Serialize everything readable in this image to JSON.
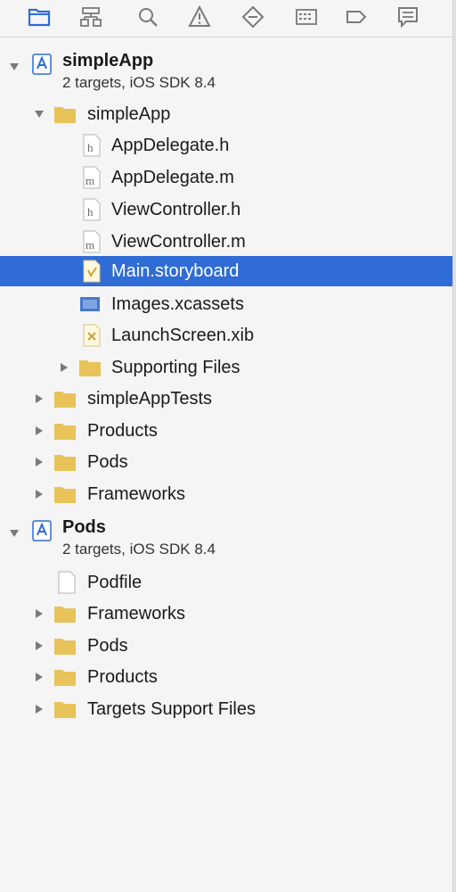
{
  "toolbar": {
    "icons": [
      "project-navigator-icon",
      "symbol-navigator-icon",
      "find-navigator-icon",
      "issue-navigator-icon",
      "test-navigator-icon",
      "debug-navigator-icon",
      "breakpoint-navigator-icon",
      "report-navigator-icon"
    ],
    "accent": "#2f6cd6"
  },
  "projects": [
    {
      "name": "simpleApp",
      "subtitle": "2 targets, iOS SDK 8.4",
      "groups": {
        "simpleApp": {
          "label": "simpleApp",
          "files": {
            "appdelegate_h": {
              "label": "AppDelegate.h",
              "icon": "header-file-icon"
            },
            "appdelegate_m": {
              "label": "AppDelegate.m",
              "icon": "source-file-icon"
            },
            "viewcontroller_h": {
              "label": "ViewController.h",
              "icon": "header-file-icon"
            },
            "viewcontroller_m": {
              "label": "ViewController.m",
              "icon": "source-file-icon"
            },
            "main_storyboard": {
              "label": "Main.storyboard",
              "icon": "storyboard-file-icon",
              "selected": true
            },
            "images_xcassets": {
              "label": "Images.xcassets",
              "icon": "asset-catalog-icon"
            },
            "launchscreen_xib": {
              "label": "LaunchScreen.xib",
              "icon": "xib-file-icon"
            }
          },
          "supporting_files": "Supporting Files"
        },
        "tests": "simpleAppTests",
        "products": "Products",
        "pods": "Pods",
        "frameworks": "Frameworks"
      }
    },
    {
      "name": "Pods",
      "subtitle": "2 targets, iOS SDK 8.4",
      "groups": {
        "podfile": "Podfile",
        "frameworks": "Frameworks",
        "pods": "Pods",
        "products": "Products",
        "targets_support": "Targets Support Files"
      }
    }
  ],
  "colors": {
    "selection": "#2f6cd6",
    "folder": "#e8c35a",
    "project_icon": "#2f6cd6"
  }
}
